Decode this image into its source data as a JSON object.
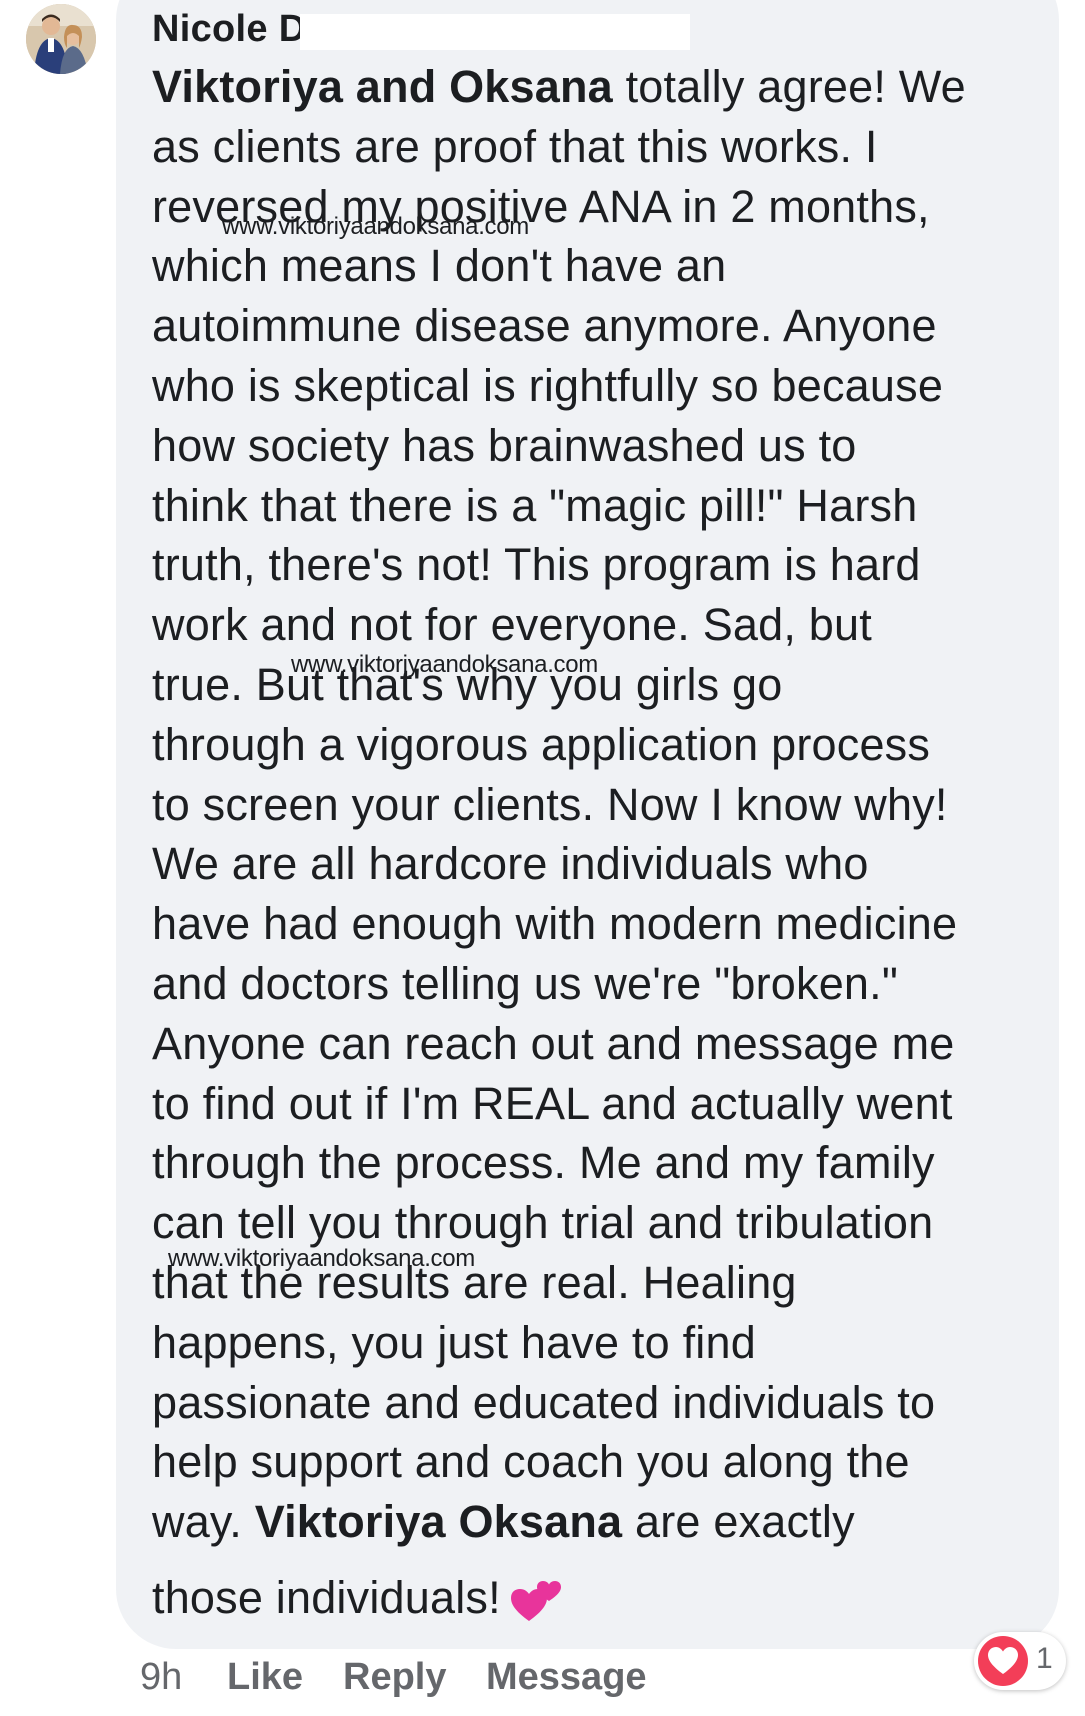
{
  "comment": {
    "author": "Nicole D",
    "lines": [
      {
        "bold": "Viktoriya and Oksana",
        "text": " totally agree! We"
      },
      {
        "bold": "",
        "text": "as clients are proof that this works. I"
      },
      {
        "bold": "",
        "text": "reversed my positive ANA in 2 months,"
      },
      {
        "bold": "",
        "text": "which means I don't have an"
      },
      {
        "bold": "",
        "text": "autoimmune disease anymore. Anyone"
      },
      {
        "bold": "",
        "text": "who is skeptical is rightfully so because"
      },
      {
        "bold": "",
        "text": "how society has brainwashed us to"
      },
      {
        "bold": "",
        "text": "think that there is a \"magic pill!\" Harsh"
      },
      {
        "bold": "",
        "text": "truth, there's not! This program is hard"
      },
      {
        "bold": "",
        "text": "work and not for everyone. Sad, but"
      },
      {
        "bold": "",
        "text": "true. But that's why you girls go"
      },
      {
        "bold": "",
        "text": "through a vigorous application process"
      },
      {
        "bold": "",
        "text": "to screen your clients. Now I know why!"
      },
      {
        "bold": "",
        "text": "We are all hardcore individuals who"
      },
      {
        "bold": "",
        "text": "have had enough with modern medicine"
      },
      {
        "bold": "",
        "text": "and doctors telling us we're \"broken.\""
      },
      {
        "bold": "",
        "text": "Anyone can reach out and message me"
      },
      {
        "bold": "",
        "text": "to find out if I'm REAL and actually went"
      },
      {
        "bold": "",
        "text": "through the process. Me and my family"
      },
      {
        "bold": "",
        "text": "can tell you through trial and tribulation"
      },
      {
        "bold": "",
        "text": "that the results are real. Healing"
      },
      {
        "bold": "",
        "text": "happens, you just have to find"
      },
      {
        "bold": "",
        "text": "passionate and educated individuals to"
      },
      {
        "bold": "",
        "text": "help support and coach you along the"
      },
      {
        "pre": "way. ",
        "bold": "Viktoriya Oksana",
        "text": " are exactly"
      }
    ],
    "last_line": "those individuals!",
    "emoji": "two-hearts-emoji",
    "watermark": "www.viktoriyaandoksana.com"
  },
  "actions": {
    "time": "9h",
    "like": "Like",
    "reply": "Reply",
    "message": "Message"
  },
  "reactions": {
    "icon": "heart-reaction-icon",
    "count": "1"
  },
  "colors": {
    "bubble": "#f0f2f5",
    "text": "#1c1e21",
    "muted": "#65676b",
    "heart": "#f33e58",
    "emoji": "#e8349b"
  }
}
